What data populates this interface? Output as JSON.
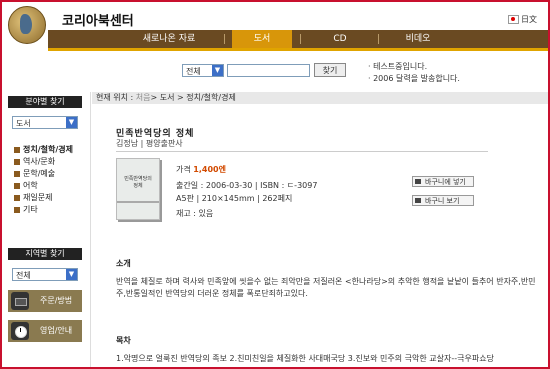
{
  "header": {
    "brand": "코리아북센터",
    "lang": "日文"
  },
  "nav": [
    "새로나온 자료",
    "도서",
    "CD",
    "비데오"
  ],
  "search": {
    "scope": "전체",
    "button": "찾기"
  },
  "notices": [
    "· 테스트중입니다.",
    "· 2006 달력을 발송합니다."
  ],
  "sidebar": {
    "category_title": "분야별 찾기",
    "category_select": "도서",
    "categories": [
      "정치/철학/경제",
      "역사/문화",
      "문학/예술",
      "어학",
      "재일문제",
      "기타"
    ],
    "region_title": "지역별 찾기",
    "region_select": "전체",
    "order_button": "주문/방법",
    "hours_button": "영업/안내"
  },
  "breadcrumb": {
    "label": "현재 위치 :",
    "first": "처음",
    "rest": "> 도서 > 정치/철학/경제"
  },
  "book": {
    "title": "민족반역당의 정체",
    "author": "김정남 | 평양출판사",
    "price_label": "가격",
    "price": "1,400엔",
    "published": "출간일 : 2006-03-30 | ISBN : ㄷ-3097",
    "format": "A5판 | 210×145mm | 262페지",
    "stock": "재고 : 있음",
    "cover_text": "민족반역당의 정체"
  },
  "actions": {
    "add_cart": "바구니에 넣기",
    "view_cart": "바구니 보기"
  },
  "intro": {
    "heading": "소개",
    "text": "반역을 체질로 하며 력사와 민족앞에 씻을수 없는 죄악만을 저질러온 <한나라당>의 추악한 행적을 낱낱이 들추어 반자주,반민주,반통일적인 반역당의 더러운 정체를 폭로단죄하고있다."
  },
  "toc": {
    "heading": "목차",
    "text": "1.악명으로 얼룩진 반역당의 족보 2.친미친일을 체질화한 사대매국당 3.진보와 민주의 극악한 교살자--극우파쇼당"
  }
}
